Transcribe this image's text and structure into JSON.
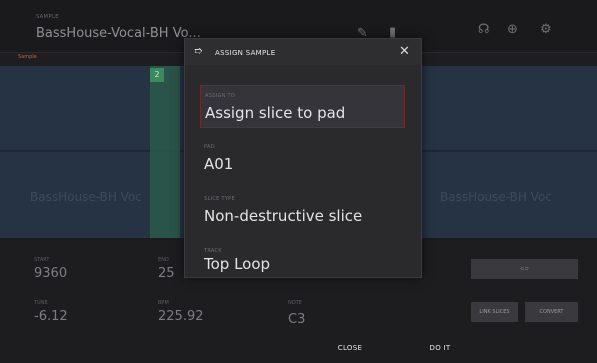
{
  "header": {
    "sample_label": "SAMPLE",
    "sample_name": "BassHouse-Vocal-BH Vo..."
  },
  "strip": {
    "label": "Sample"
  },
  "waveform": {
    "slice_tag": "2",
    "left_text": "BassHouse-BH Voc",
    "right_text": "BassHouse-BH Voc"
  },
  "bottom": {
    "params": [
      {
        "label": "START",
        "value": "9360"
      },
      {
        "label": "TUNE",
        "value": "-6.12"
      },
      {
        "label": "END",
        "value": "25"
      },
      {
        "label": "BPM",
        "value": "225.92"
      },
      {
        "label": "NOTE",
        "value": "C3"
      }
    ],
    "right_buttons": {
      "link_label": "LINK",
      "slice_btn": "LINK SLICES",
      "convert_btn": "CONVERT"
    },
    "footer": {
      "close": "CLOSE",
      "do_it": "DO IT"
    }
  },
  "modal": {
    "title": "ASSIGN SAMPLE",
    "close_icon": "close-icon",
    "fields": [
      {
        "label": "ASSIGN TO",
        "value": "Assign slice to pad"
      },
      {
        "label": "PAD",
        "value": "A01"
      },
      {
        "label": "SLICE TYPE",
        "value": "Non-destructive slice"
      },
      {
        "label": "TRACK",
        "value": "Top Loop"
      }
    ]
  },
  "colors": {
    "accent": "#d9583a",
    "active_border": "#6e2a2a",
    "waveform_bg": "#263344",
    "slice_green": "#2c5a4a"
  }
}
